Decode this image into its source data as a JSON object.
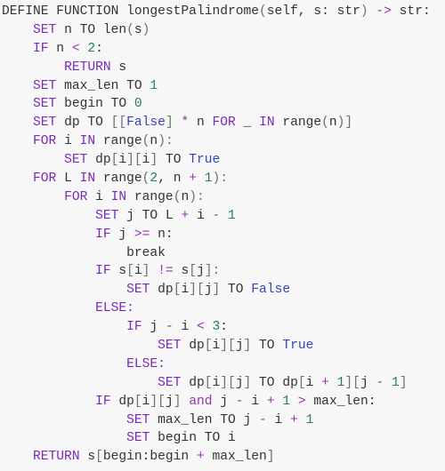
{
  "lines": [
    {
      "indent": 0,
      "tokens": [
        {
          "t": "DEFINE FUNCTION longestPalindrome",
          "c": "n"
        },
        {
          "t": "(",
          "c": "p"
        },
        {
          "t": "self, s: str",
          "c": "n"
        },
        {
          "t": ")",
          "c": "p"
        },
        {
          "t": " ",
          "c": "n"
        },
        {
          "t": "->",
          "c": "o"
        },
        {
          "t": " str:",
          "c": "n"
        }
      ]
    },
    {
      "indent": 1,
      "tokens": [
        {
          "t": "SET",
          "c": "k"
        },
        {
          "t": " n TO len",
          "c": "n"
        },
        {
          "t": "(",
          "c": "p"
        },
        {
          "t": "s",
          "c": "n"
        },
        {
          "t": ")",
          "c": "p"
        }
      ]
    },
    {
      "indent": 1,
      "tokens": [
        {
          "t": "IF",
          "c": "k"
        },
        {
          "t": " n ",
          "c": "n"
        },
        {
          "t": "<",
          "c": "o"
        },
        {
          "t": " ",
          "c": "n"
        },
        {
          "t": "2",
          "c": "m"
        },
        {
          "t": ":",
          "c": "n"
        }
      ]
    },
    {
      "indent": 2,
      "tokens": [
        {
          "t": "RETURN",
          "c": "k"
        },
        {
          "t": " s",
          "c": "n"
        }
      ]
    },
    {
      "indent": 1,
      "tokens": [
        {
          "t": "SET",
          "c": "k"
        },
        {
          "t": " max_len TO ",
          "c": "n"
        },
        {
          "t": "1",
          "c": "m"
        }
      ]
    },
    {
      "indent": 1,
      "tokens": [
        {
          "t": "SET",
          "c": "k"
        },
        {
          "t": " begin TO ",
          "c": "n"
        },
        {
          "t": "0",
          "c": "m"
        }
      ]
    },
    {
      "indent": 1,
      "tokens": [
        {
          "t": "SET",
          "c": "k"
        },
        {
          "t": " dp TO ",
          "c": "n"
        },
        {
          "t": "[[",
          "c": "p"
        },
        {
          "t": "False",
          "c": "c"
        },
        {
          "t": "]",
          "c": "p"
        },
        {
          "t": " ",
          "c": "n"
        },
        {
          "t": "*",
          "c": "o"
        },
        {
          "t": " n ",
          "c": "n"
        },
        {
          "t": "FOR",
          "c": "k"
        },
        {
          "t": " _ ",
          "c": "n"
        },
        {
          "t": "IN",
          "c": "k"
        },
        {
          "t": " range",
          "c": "n"
        },
        {
          "t": "(",
          "c": "p"
        },
        {
          "t": "n",
          "c": "n"
        },
        {
          "t": ")]",
          "c": "p"
        }
      ]
    },
    {
      "indent": 1,
      "tokens": [
        {
          "t": "FOR",
          "c": "k"
        },
        {
          "t": " i ",
          "c": "n"
        },
        {
          "t": "IN",
          "c": "k"
        },
        {
          "t": " range",
          "c": "n"
        },
        {
          "t": "(",
          "c": "p"
        },
        {
          "t": "n",
          "c": "n"
        },
        {
          "t": "):",
          "c": "p"
        }
      ]
    },
    {
      "indent": 2,
      "tokens": [
        {
          "t": "SET",
          "c": "k"
        },
        {
          "t": " dp",
          "c": "n"
        },
        {
          "t": "[",
          "c": "p"
        },
        {
          "t": "i",
          "c": "n"
        },
        {
          "t": "][",
          "c": "p"
        },
        {
          "t": "i",
          "c": "n"
        },
        {
          "t": "]",
          "c": "p"
        },
        {
          "t": " TO ",
          "c": "n"
        },
        {
          "t": "True",
          "c": "c"
        }
      ]
    },
    {
      "indent": 1,
      "tokens": [
        {
          "t": "FOR",
          "c": "k"
        },
        {
          "t": " L ",
          "c": "n"
        },
        {
          "t": "IN",
          "c": "k"
        },
        {
          "t": " range",
          "c": "n"
        },
        {
          "t": "(",
          "c": "p"
        },
        {
          "t": "2",
          "c": "m"
        },
        {
          "t": ", n ",
          "c": "n"
        },
        {
          "t": "+",
          "c": "o"
        },
        {
          "t": " ",
          "c": "n"
        },
        {
          "t": "1",
          "c": "m"
        },
        {
          "t": "):",
          "c": "p"
        }
      ]
    },
    {
      "indent": 2,
      "tokens": [
        {
          "t": "FOR",
          "c": "k"
        },
        {
          "t": " i ",
          "c": "n"
        },
        {
          "t": "IN",
          "c": "k"
        },
        {
          "t": " range",
          "c": "n"
        },
        {
          "t": "(",
          "c": "p"
        },
        {
          "t": "n",
          "c": "n"
        },
        {
          "t": "):",
          "c": "p"
        }
      ]
    },
    {
      "indent": 3,
      "tokens": [
        {
          "t": "SET",
          "c": "k"
        },
        {
          "t": " j TO L ",
          "c": "n"
        },
        {
          "t": "+",
          "c": "o"
        },
        {
          "t": " i ",
          "c": "n"
        },
        {
          "t": "-",
          "c": "o"
        },
        {
          "t": " ",
          "c": "n"
        },
        {
          "t": "1",
          "c": "m"
        }
      ]
    },
    {
      "indent": 3,
      "tokens": [
        {
          "t": "IF",
          "c": "k"
        },
        {
          "t": " j ",
          "c": "n"
        },
        {
          "t": ">=",
          "c": "o"
        },
        {
          "t": " n:",
          "c": "n"
        }
      ]
    },
    {
      "indent": 4,
      "tokens": [
        {
          "t": "break",
          "c": "n"
        }
      ]
    },
    {
      "indent": 3,
      "tokens": [
        {
          "t": "IF",
          "c": "k"
        },
        {
          "t": " s",
          "c": "n"
        },
        {
          "t": "[",
          "c": "p"
        },
        {
          "t": "i",
          "c": "n"
        },
        {
          "t": "]",
          "c": "p"
        },
        {
          "t": " ",
          "c": "n"
        },
        {
          "t": "!=",
          "c": "o"
        },
        {
          "t": " s",
          "c": "n"
        },
        {
          "t": "[",
          "c": "p"
        },
        {
          "t": "j",
          "c": "n"
        },
        {
          "t": "]:",
          "c": "p"
        }
      ]
    },
    {
      "indent": 4,
      "tokens": [
        {
          "t": "SET",
          "c": "k"
        },
        {
          "t": " dp",
          "c": "n"
        },
        {
          "t": "[",
          "c": "p"
        },
        {
          "t": "i",
          "c": "n"
        },
        {
          "t": "][",
          "c": "p"
        },
        {
          "t": "j",
          "c": "n"
        },
        {
          "t": "]",
          "c": "p"
        },
        {
          "t": " TO ",
          "c": "n"
        },
        {
          "t": "False",
          "c": "c"
        }
      ]
    },
    {
      "indent": 3,
      "tokens": [
        {
          "t": "ELSE:",
          "c": "k"
        }
      ]
    },
    {
      "indent": 4,
      "tokens": [
        {
          "t": "IF",
          "c": "k"
        },
        {
          "t": " j ",
          "c": "n"
        },
        {
          "t": "-",
          "c": "o"
        },
        {
          "t": " i ",
          "c": "n"
        },
        {
          "t": "<",
          "c": "o"
        },
        {
          "t": " ",
          "c": "n"
        },
        {
          "t": "3",
          "c": "m"
        },
        {
          "t": ":",
          "c": "n"
        }
      ]
    },
    {
      "indent": 5,
      "tokens": [
        {
          "t": "SET",
          "c": "k"
        },
        {
          "t": " dp",
          "c": "n"
        },
        {
          "t": "[",
          "c": "p"
        },
        {
          "t": "i",
          "c": "n"
        },
        {
          "t": "][",
          "c": "p"
        },
        {
          "t": "j",
          "c": "n"
        },
        {
          "t": "]",
          "c": "p"
        },
        {
          "t": " TO ",
          "c": "n"
        },
        {
          "t": "True",
          "c": "c"
        }
      ]
    },
    {
      "indent": 4,
      "tokens": [
        {
          "t": "ELSE:",
          "c": "k"
        }
      ]
    },
    {
      "indent": 5,
      "tokens": [
        {
          "t": "SET",
          "c": "k"
        },
        {
          "t": " dp",
          "c": "n"
        },
        {
          "t": "[",
          "c": "p"
        },
        {
          "t": "i",
          "c": "n"
        },
        {
          "t": "][",
          "c": "p"
        },
        {
          "t": "j",
          "c": "n"
        },
        {
          "t": "]",
          "c": "p"
        },
        {
          "t": " TO dp",
          "c": "n"
        },
        {
          "t": "[",
          "c": "p"
        },
        {
          "t": "i ",
          "c": "n"
        },
        {
          "t": "+",
          "c": "o"
        },
        {
          "t": " ",
          "c": "n"
        },
        {
          "t": "1",
          "c": "m"
        },
        {
          "t": "][",
          "c": "p"
        },
        {
          "t": "j ",
          "c": "n"
        },
        {
          "t": "-",
          "c": "o"
        },
        {
          "t": " ",
          "c": "n"
        },
        {
          "t": "1",
          "c": "m"
        },
        {
          "t": "]",
          "c": "p"
        }
      ]
    },
    {
      "indent": 3,
      "tokens": [
        {
          "t": "IF",
          "c": "k"
        },
        {
          "t": " dp",
          "c": "n"
        },
        {
          "t": "[",
          "c": "p"
        },
        {
          "t": "i",
          "c": "n"
        },
        {
          "t": "][",
          "c": "p"
        },
        {
          "t": "j",
          "c": "n"
        },
        {
          "t": "]",
          "c": "p"
        },
        {
          "t": " ",
          "c": "n"
        },
        {
          "t": "and",
          "c": "o"
        },
        {
          "t": " j ",
          "c": "n"
        },
        {
          "t": "-",
          "c": "o"
        },
        {
          "t": " i ",
          "c": "n"
        },
        {
          "t": "+",
          "c": "o"
        },
        {
          "t": " ",
          "c": "n"
        },
        {
          "t": "1",
          "c": "m"
        },
        {
          "t": " ",
          "c": "n"
        },
        {
          "t": ">",
          "c": "o"
        },
        {
          "t": " max_len:",
          "c": "n"
        }
      ]
    },
    {
      "indent": 4,
      "tokens": [
        {
          "t": "SET",
          "c": "k"
        },
        {
          "t": " max_len TO j ",
          "c": "n"
        },
        {
          "t": "-",
          "c": "o"
        },
        {
          "t": " i ",
          "c": "n"
        },
        {
          "t": "+",
          "c": "o"
        },
        {
          "t": " ",
          "c": "n"
        },
        {
          "t": "1",
          "c": "m"
        }
      ]
    },
    {
      "indent": 4,
      "tokens": [
        {
          "t": "SET",
          "c": "k"
        },
        {
          "t": " begin TO i",
          "c": "n"
        }
      ]
    },
    {
      "indent": 1,
      "tokens": [
        {
          "t": "RETURN",
          "c": "k"
        },
        {
          "t": " s",
          "c": "n"
        },
        {
          "t": "[",
          "c": "p"
        },
        {
          "t": "begin:begin ",
          "c": "n"
        },
        {
          "t": "+",
          "c": "o"
        },
        {
          "t": " max_len",
          "c": "n"
        },
        {
          "t": "]",
          "c": "p"
        }
      ]
    }
  ]
}
